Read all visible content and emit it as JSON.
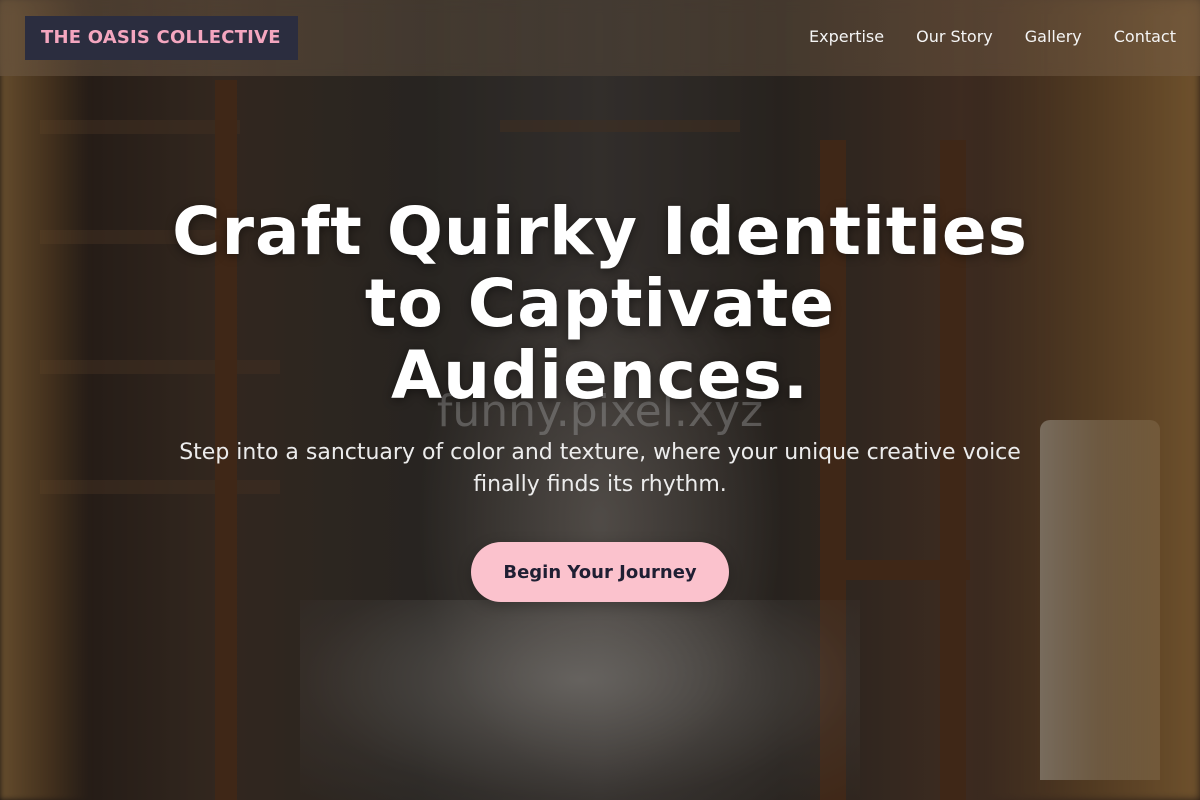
{
  "brand": {
    "name": "THE OASIS COLLECTIVE",
    "text_color": "#f4a6bf",
    "background_color": "#2b2d3f"
  },
  "nav": {
    "items": [
      {
        "label": "Expertise"
      },
      {
        "label": "Our Story"
      },
      {
        "label": "Gallery"
      },
      {
        "label": "Contact"
      }
    ]
  },
  "hero": {
    "headline": "Craft Quirky Identities to Captivate Audiences.",
    "background_watermark": "funny.pixel.xyz",
    "subtitle": "Step into a sanctuary of color and texture, where your unique creative voice finally finds its rhythm.",
    "cta_label": "Begin Your Journey",
    "cta_color": "#fbc2cd",
    "background_image": "dim antique workshop interior with shelves of pottery, wooden easels and golden curtains"
  }
}
